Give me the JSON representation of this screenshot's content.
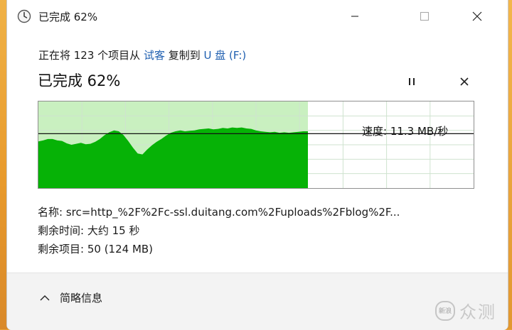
{
  "window": {
    "title": "已完成 62%"
  },
  "transfer": {
    "prefix": "正在将 123 个项目从",
    "source": "试客",
    "middle": "复制到",
    "destination": "U 盘 (F:)"
  },
  "progress": {
    "status_text": "已完成 62%",
    "percent": 62,
    "speed_label": "速度: 11.3 MB/秒"
  },
  "details": {
    "name_label": "名称:",
    "name_value": "src=http_%2F%2Fc-ssl.duitang.com%2Fuploads%2Fblog%2F...",
    "time_label": "剩余时间:",
    "time_value": "大约 15 秒",
    "items_label": "剩余项目:",
    "items_value": "50 (124 MB)"
  },
  "footer": {
    "less_details_label": "简略信息"
  },
  "watermark": {
    "badge": "新浪",
    "text": "众测"
  },
  "colors": {
    "progress_fill": "#c9f0c0",
    "graph_fill": "#06b206",
    "link": "#1f5fb0"
  },
  "chart_data": {
    "type": "area",
    "speed_trace": [
      9.7,
      9.9,
      10.2,
      10.2,
      9.9,
      9.8,
      9.3,
      9.0,
      9.2,
      9.4,
      9.1,
      9.2,
      9.6,
      10.2,
      11.0,
      11.6,
      12.0,
      11.8,
      11.0,
      9.8,
      8.4,
      7.2,
      7.0,
      8.0,
      8.9,
      9.6,
      10.2,
      10.9,
      11.5,
      11.8,
      12.0,
      11.8,
      11.9,
      12.0,
      12.2,
      12.3,
      12.4,
      12.2,
      12.3,
      12.5,
      12.4,
      12.6,
      12.5,
      12.6,
      12.4,
      12.3,
      12.0,
      11.8,
      11.7,
      11.6,
      11.7,
      11.5,
      11.6,
      11.5,
      11.6,
      11.7,
      11.8,
      11.8
    ],
    "current_speed": 11.3,
    "progress_fraction": 0.62
  }
}
